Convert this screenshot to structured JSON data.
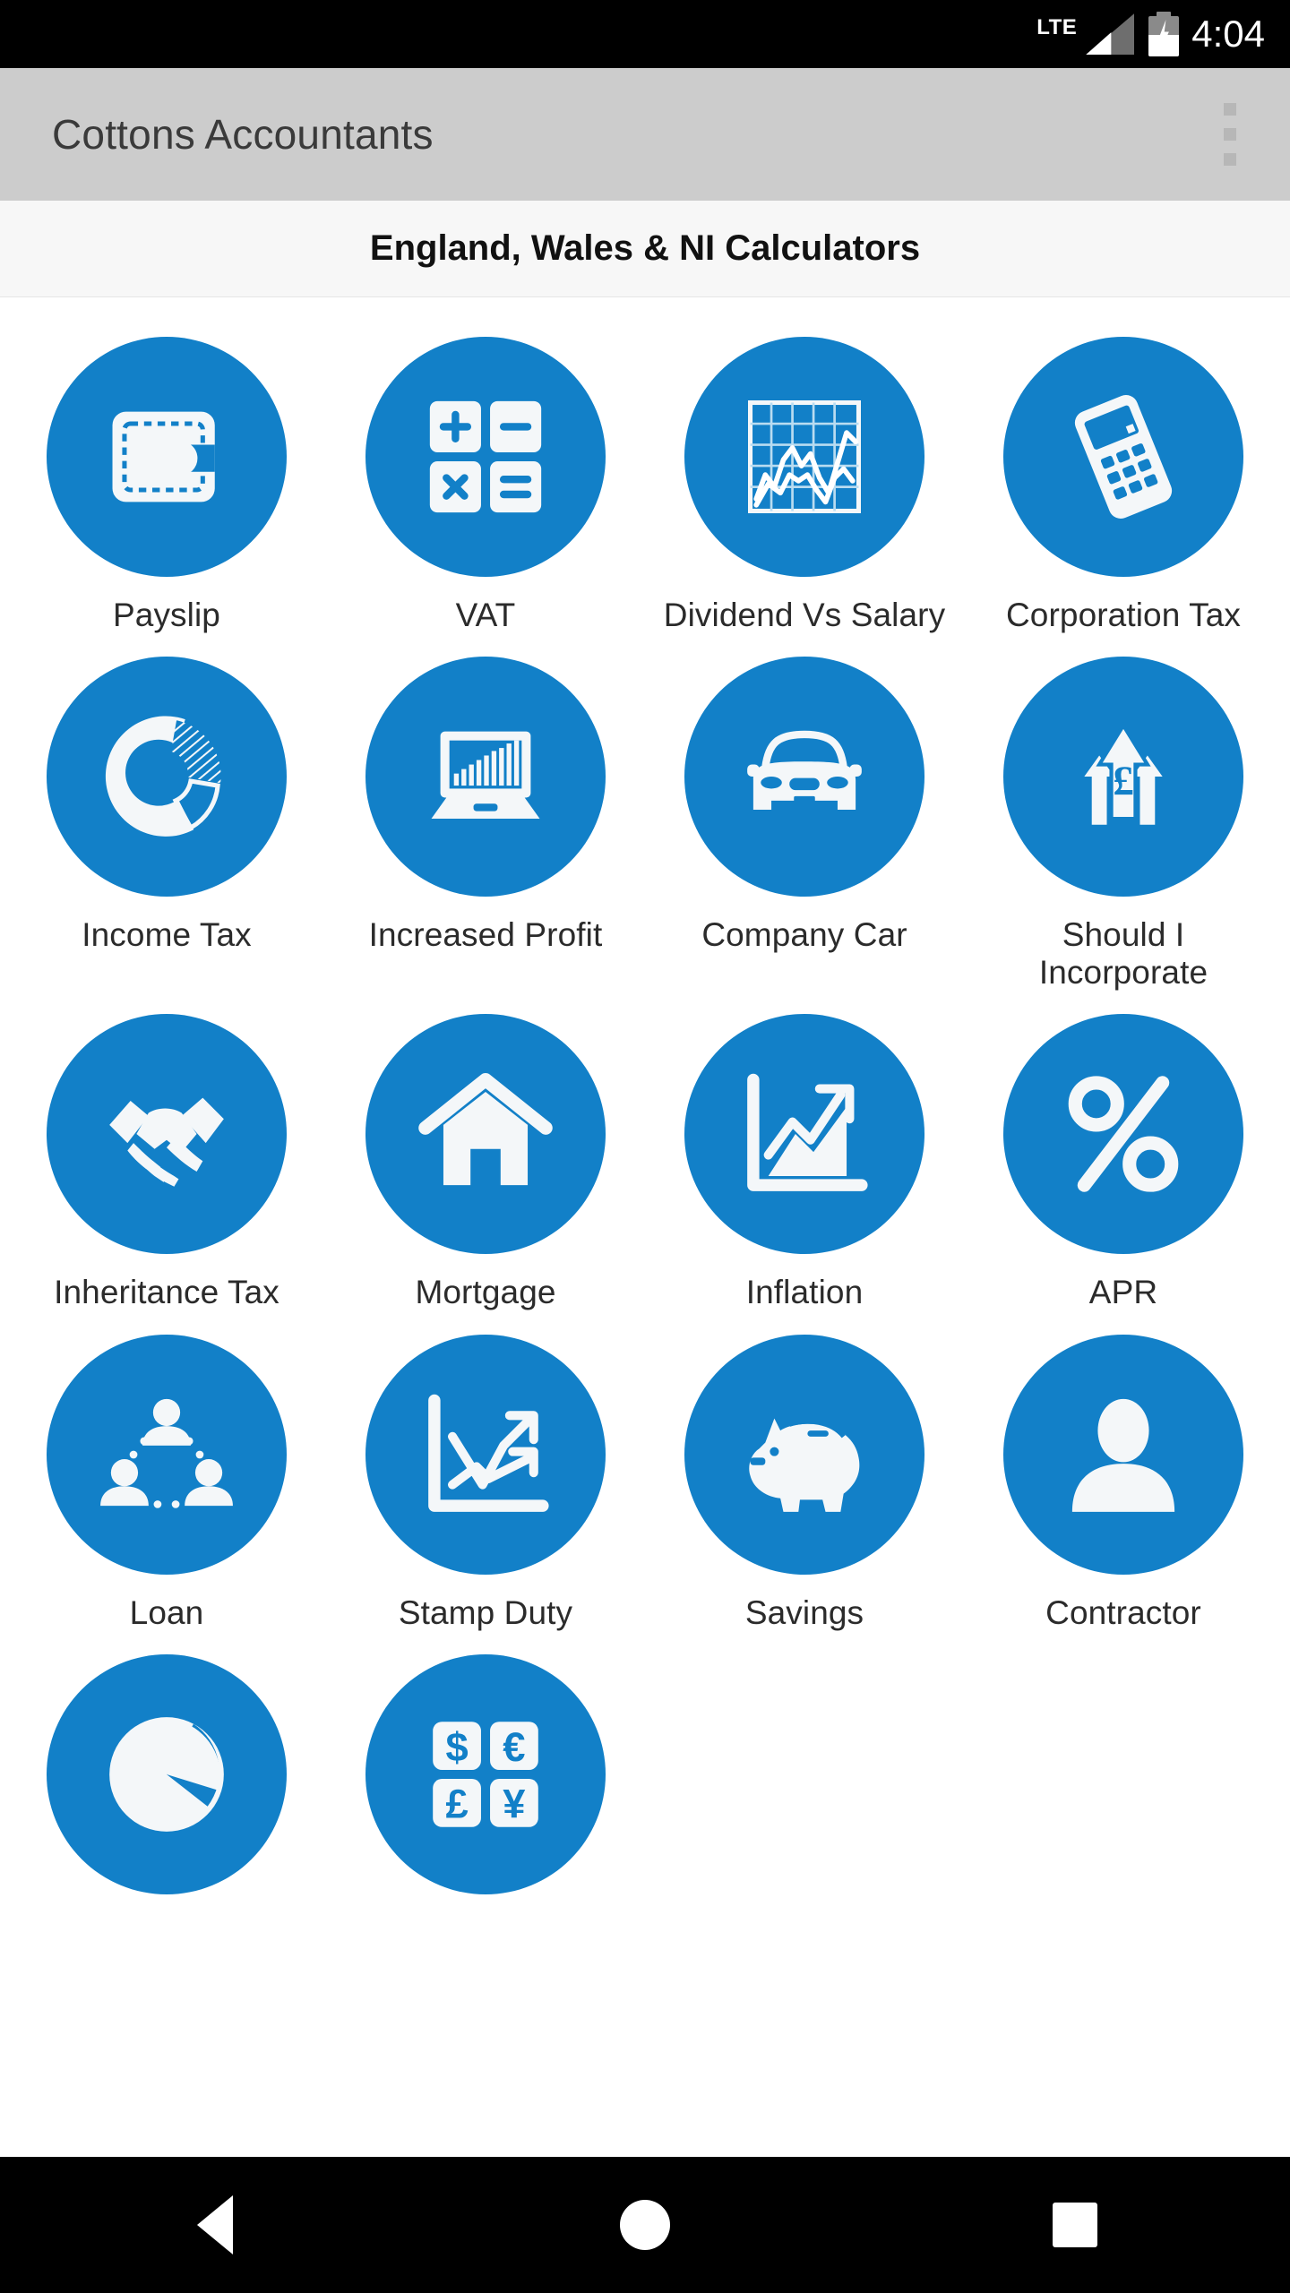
{
  "status_bar": {
    "network_label": "LTE",
    "signal_icon": "signal-bars-icon",
    "battery_icon": "battery-charging-icon",
    "time": "4:04"
  },
  "app_bar": {
    "title": "Cottons Accountants",
    "overflow_icon": "overflow-menu-icon"
  },
  "subheader": {
    "title": "England, Wales & NI Calculators"
  },
  "colors": {
    "brand_blue": "#1280C8",
    "app_bar_bg": "#cccccc",
    "subheader_bg": "#f7f7f7",
    "icon_white": "#f4f7f9",
    "label_text": "#2b2b2b"
  },
  "grid": {
    "items": [
      {
        "label": "Payslip",
        "icon": "wallet-icon"
      },
      {
        "label": "VAT",
        "icon": "calculator-keys-icon"
      },
      {
        "label": "Dividend Vs Salary",
        "icon": "line-chart-grid-icon"
      },
      {
        "label": "Corporation Tax",
        "icon": "handheld-calculator-icon"
      },
      {
        "label": "Income Tax",
        "icon": "donut-chart-icon"
      },
      {
        "label": "Increased Profit",
        "icon": "laptop-bar-chart-icon"
      },
      {
        "label": "Company Car",
        "icon": "car-front-icon"
      },
      {
        "label": "Should I Incorporate",
        "icon": "up-arrows-pound-icon"
      },
      {
        "label": "Inheritance Tax",
        "icon": "handshake-icon"
      },
      {
        "label": "Mortgage",
        "icon": "house-icon"
      },
      {
        "label": "Inflation",
        "icon": "area-chart-arrow-icon"
      },
      {
        "label": "APR",
        "icon": "percent-icon"
      },
      {
        "label": "Loan",
        "icon": "people-network-icon"
      },
      {
        "label": "Stamp Duty",
        "icon": "crossing-trends-icon"
      },
      {
        "label": "Savings",
        "icon": "piggy-bank-icon"
      },
      {
        "label": "Contractor",
        "icon": "person-silhouette-icon"
      },
      {
        "label": "",
        "icon": "pie-chart-icon"
      },
      {
        "label": "",
        "icon": "currency-keys-icon"
      }
    ]
  },
  "nav_bar": {
    "back": "back-icon",
    "home": "home-icon",
    "recents": "recents-icon"
  }
}
